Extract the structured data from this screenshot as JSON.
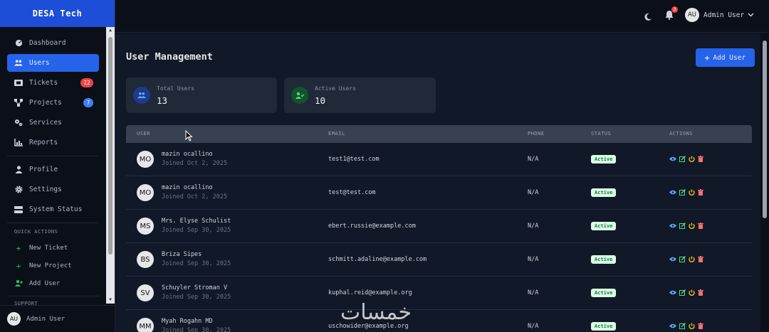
{
  "brand": "DESA Tech",
  "nav": [
    {
      "label": "Dashboard",
      "icon": "dashboard-icon",
      "active": false
    },
    {
      "label": "Users",
      "icon": "users-icon",
      "active": true
    },
    {
      "label": "Tickets",
      "icon": "ticket-icon",
      "badge": "12",
      "badge_color": "#ef4444"
    },
    {
      "label": "Projects",
      "icon": "projects-icon",
      "badge": "7",
      "badge_color": "#3b82f6"
    },
    {
      "label": "Services",
      "icon": "services-icon"
    },
    {
      "label": "Reports",
      "icon": "reports-icon"
    },
    {
      "label": "Profile",
      "icon": "profile-icon"
    },
    {
      "label": "Settings",
      "icon": "settings-icon"
    },
    {
      "label": "System Status",
      "icon": "server-icon"
    }
  ],
  "quick_actions": {
    "title": "QUICK ACTIONS",
    "items": [
      {
        "label": "New Ticket",
        "icon": "plus-icon"
      },
      {
        "label": "New Project",
        "icon": "plus-icon"
      },
      {
        "label": "Add User",
        "icon": "add-user-icon"
      }
    ]
  },
  "support_label": "SUPPORT",
  "sidebar_user": {
    "initials": "AU",
    "name": "Admin User"
  },
  "topbar": {
    "user_initials": "AU",
    "user_name": "Admin User",
    "notification_count": "3"
  },
  "page": {
    "title": "User Management",
    "add_button": "Add User"
  },
  "stats": [
    {
      "label": "Total Users",
      "value": "13",
      "icon": "users-icon",
      "color": "#60a5fa"
    },
    {
      "label": "Active Users",
      "value": "10",
      "icon": "user-check-icon",
      "color": "#4ade80"
    }
  ],
  "table": {
    "columns": [
      "USER",
      "EMAIL",
      "PHONE",
      "STATUS",
      "ACTIONS"
    ],
    "rows": [
      {
        "initials": "MO",
        "name": "mazin ocallino",
        "joined": "Joined Oct 2, 2025",
        "email": "test1@test.com",
        "phone": "N/A",
        "status": "Active"
      },
      {
        "initials": "MO",
        "name": "mazin ocallino",
        "joined": "Joined Oct 2, 2025",
        "email": "test@test.com",
        "phone": "N/A",
        "status": "Active"
      },
      {
        "initials": "MS",
        "name": "Mrs. Elyse Schulist",
        "joined": "Joined Sep 30, 2025",
        "email": "ebert.russie@example.com",
        "phone": "N/A",
        "status": "Active"
      },
      {
        "initials": "BS",
        "name": "Briza Sipes",
        "joined": "Joined Sep 30, 2025",
        "email": "schmitt.adaline@example.com",
        "phone": "N/A",
        "status": "Active"
      },
      {
        "initials": "SV",
        "name": "Schuyler Stroman V",
        "joined": "Joined Sep 30, 2025",
        "email": "kuphal.reid@example.org",
        "phone": "N/A",
        "status": "Active"
      },
      {
        "initials": "MM",
        "name": "Myah Rogahn MD",
        "joined": "Joined Sep 30, 2025",
        "email": "uschowider@example.org",
        "phone": "N/A",
        "status": "Active"
      }
    ]
  },
  "watermark": "خمسات"
}
